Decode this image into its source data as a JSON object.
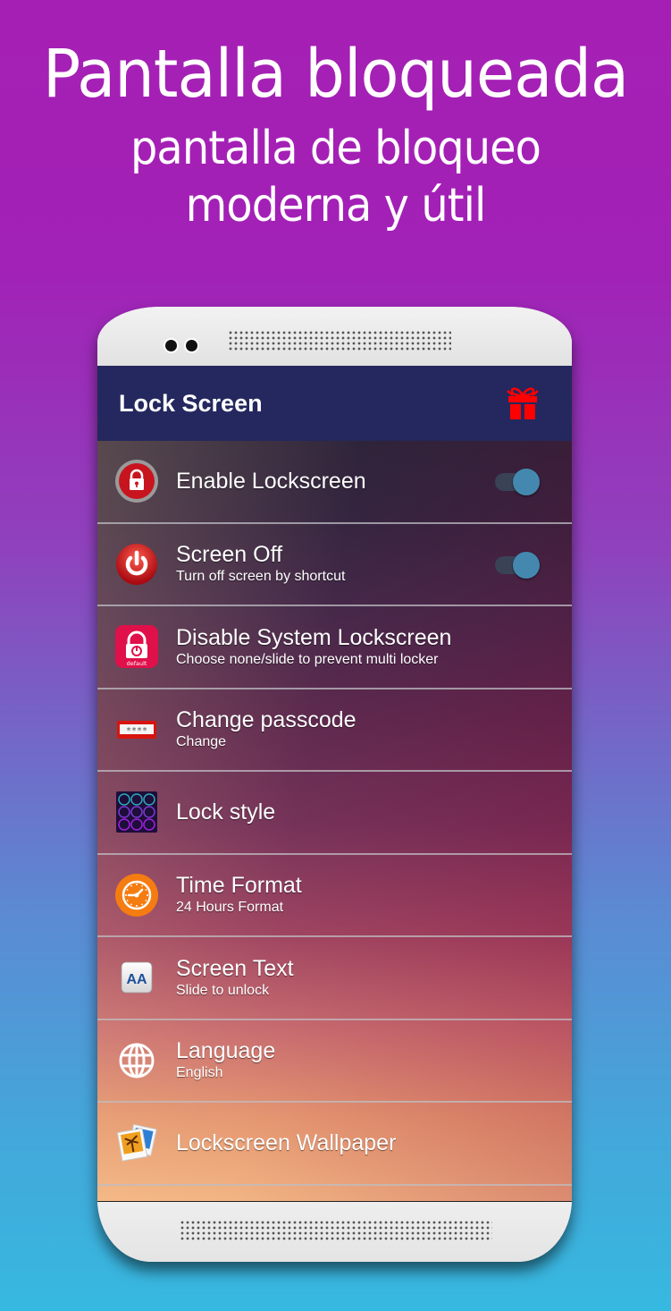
{
  "promo": {
    "headline": "Pantalla bloqueada",
    "subline1": "pantalla de bloqueo",
    "subline2": "moderna y útil"
  },
  "app": {
    "title": "Lock Screen",
    "gift_icon": "gift-icon",
    "accent_color": "#24285e",
    "toggle_color": "#4488b0"
  },
  "settings": [
    {
      "icon": "lock-icon",
      "title": "Enable Lockscreen",
      "subtitle": "",
      "toggle": true,
      "toggle_on": true
    },
    {
      "icon": "power-icon",
      "title": "Screen Off",
      "subtitle": "Turn off screen by shortcut",
      "toggle": true,
      "toggle_on": true
    },
    {
      "icon": "default-lock-icon",
      "title": "Disable System Lockscreen",
      "subtitle": "Choose none/slide to prevent multi locker",
      "toggle": false,
      "icon_label": "default"
    },
    {
      "icon": "passcode-icon",
      "title": "Change passcode",
      "subtitle": "Change",
      "toggle": false,
      "icon_label": "****"
    },
    {
      "icon": "keypad-icon",
      "title": "Lock style",
      "subtitle": "",
      "toggle": false
    },
    {
      "icon": "clock-icon",
      "title": "Time Format",
      "subtitle": "24 Hours Format",
      "toggle": false
    },
    {
      "icon": "text-icon",
      "title": "Screen Text",
      "subtitle": "Slide to unlock",
      "toggle": false,
      "icon_label": "AA"
    },
    {
      "icon": "globe-icon",
      "title": "Language",
      "subtitle": "English",
      "toggle": false
    },
    {
      "icon": "photos-icon",
      "title": "Lockscreen Wallpaper",
      "subtitle": "",
      "toggle": false
    }
  ]
}
